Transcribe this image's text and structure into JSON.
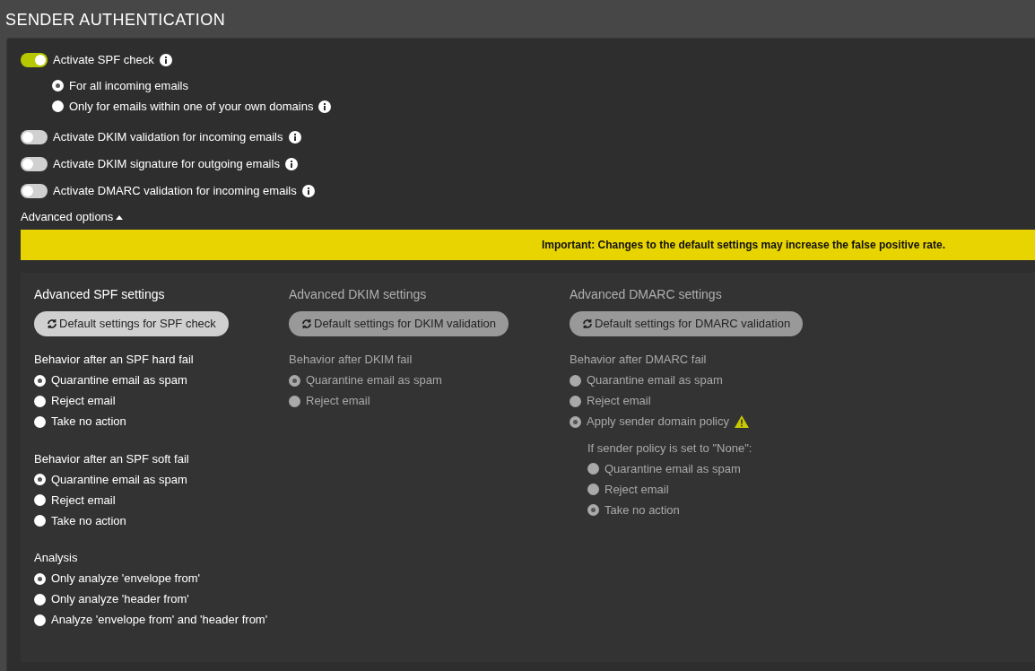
{
  "title": "SENDER AUTHENTICATION",
  "toggles": [
    {
      "label": "Activate SPF check",
      "on": true,
      "options": [
        {
          "label": "For all incoming emails",
          "selected": true,
          "info": false
        },
        {
          "label": "Only for emails within one of your own domains",
          "selected": false,
          "info": true
        }
      ]
    },
    {
      "label": "Activate DKIM validation for incoming emails",
      "on": false
    },
    {
      "label": "Activate DKIM signature for outgoing emails",
      "on": false
    },
    {
      "label": "Activate DMARC validation for incoming emails",
      "on": false
    }
  ],
  "advanced": {
    "label": "Advanced options",
    "expanded": true
  },
  "notice": "Important: Changes to the default settings may increase the false positive rate.",
  "columns": [
    {
      "title": "Advanced SPF settings",
      "disabled": false,
      "reset_button": "Default settings for SPF check",
      "groups": [
        {
          "label": "Behavior after an SPF hard fail",
          "options": [
            {
              "label": "Quarantine email as spam",
              "selected": true
            },
            {
              "label": "Reject email",
              "selected": false
            },
            {
              "label": "Take no action",
              "selected": false
            }
          ]
        },
        {
          "label": "Behavior after an SPF soft fail",
          "options": [
            {
              "label": "Quarantine email as spam",
              "selected": true
            },
            {
              "label": "Reject email",
              "selected": false
            },
            {
              "label": "Take no action",
              "selected": false
            }
          ]
        },
        {
          "label": "Analysis",
          "options": [
            {
              "label": "Only analyze 'envelope from'",
              "selected": true
            },
            {
              "label": "Only analyze 'header from'",
              "selected": false
            },
            {
              "label": "Analyze 'envelope from' and 'header from'",
              "selected": false
            }
          ]
        }
      ]
    },
    {
      "title": "Advanced DKIM settings",
      "disabled": true,
      "reset_button": "Default settings for DKIM validation",
      "groups": [
        {
          "label": "Behavior after DKIM fail",
          "options": [
            {
              "label": "Quarantine email as spam",
              "selected": true
            },
            {
              "label": "Reject email",
              "selected": false
            }
          ]
        }
      ]
    },
    {
      "title": "Advanced DMARC settings",
      "disabled": true,
      "reset_button": "Default settings for DMARC validation",
      "groups": [
        {
          "label": "Behavior after DMARC fail",
          "options": [
            {
              "label": "Quarantine email as spam",
              "selected": false
            },
            {
              "label": "Reject email",
              "selected": false
            },
            {
              "label": "Apply sender domain policy",
              "selected": true,
              "warning": true
            }
          ],
          "sub_group": {
            "label": "If sender policy is set to \"None\":",
            "options": [
              {
                "label": "Quarantine email as spam",
                "selected": false
              },
              {
                "label": "Reject email",
                "selected": false
              },
              {
                "label": "Take no action",
                "selected": true
              }
            ]
          }
        }
      ]
    }
  ]
}
